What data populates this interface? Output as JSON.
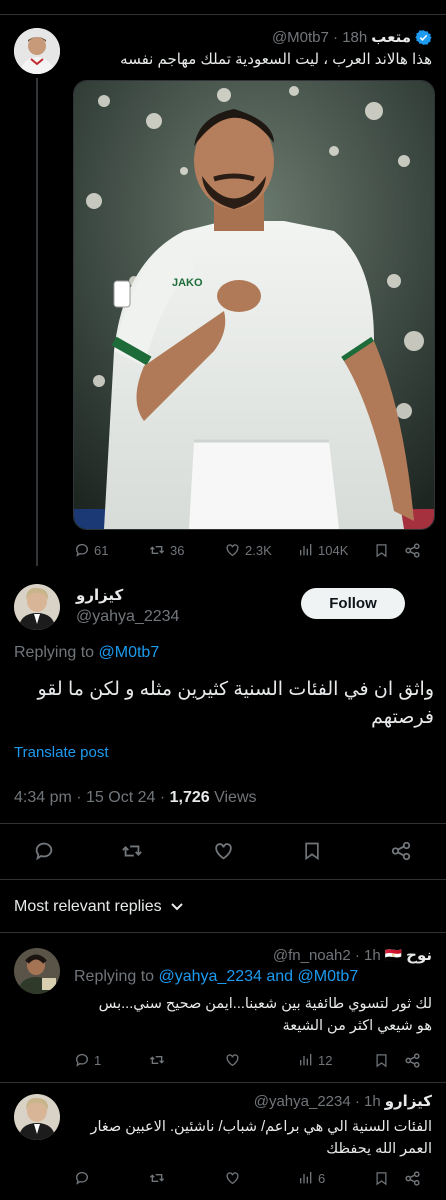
{
  "parent_tweet": {
    "name": "متعب",
    "handle": "@M0tb7",
    "time": "18h",
    "text": "هذا هالاند العرب ، ليت السعودية تملك مهاجم نفسه",
    "verified": true,
    "stats": {
      "replies": "61",
      "retweets": "36",
      "likes": "2.3K",
      "views": "104K"
    }
  },
  "main_tweet": {
    "name": "كيزارو",
    "handle": "@yahya_2234",
    "follow_label": "Follow",
    "replying_prefix": "Replying to",
    "replying_to": "@M0tb7",
    "text_line1": "واثق ان في الفئات السنية كثيرين مثله و لكن ما لقو",
    "text_line2": "فرصتهم",
    "translate": "Translate post",
    "time": "4:34 pm · 15 Oct 24 · ",
    "views_count": "1,726",
    "views_label": " Views"
  },
  "replies_header": "Most relevant replies",
  "replies": [
    {
      "name": "نوح",
      "flag": "🇪🇬",
      "handle": "@fn_noah2",
      "time": "1h",
      "replying_prefix": "Replying to",
      "replying_to": "@yahya_2234 and @M0tb7",
      "text_line1": "لك ثور لتسوي طائفية بين شعبنا...ايمن صحيح سني...بس",
      "text_line2": "هو شيعي اكثر من الشيعة",
      "stats": {
        "replies": "1",
        "views": "12"
      }
    },
    {
      "name": "كيزارو",
      "handle": "@yahya_2234",
      "time": "1h",
      "text_line1": "الفئات السنية الي هي براعم/ شباب/ ناشئين. الاعبين صغار",
      "text_line2": "العمر الله يحفظك",
      "stats": {
        "views": "6"
      }
    }
  ],
  "colors": {
    "accent": "#1d9bf0",
    "background": "#000000",
    "divider": "#2f3336"
  },
  "icons": [
    "verified-badge-icon",
    "reply-icon",
    "retweet-icon",
    "like-icon",
    "views-icon",
    "bookmark-icon",
    "share-icon",
    "chevron-down-icon"
  ]
}
